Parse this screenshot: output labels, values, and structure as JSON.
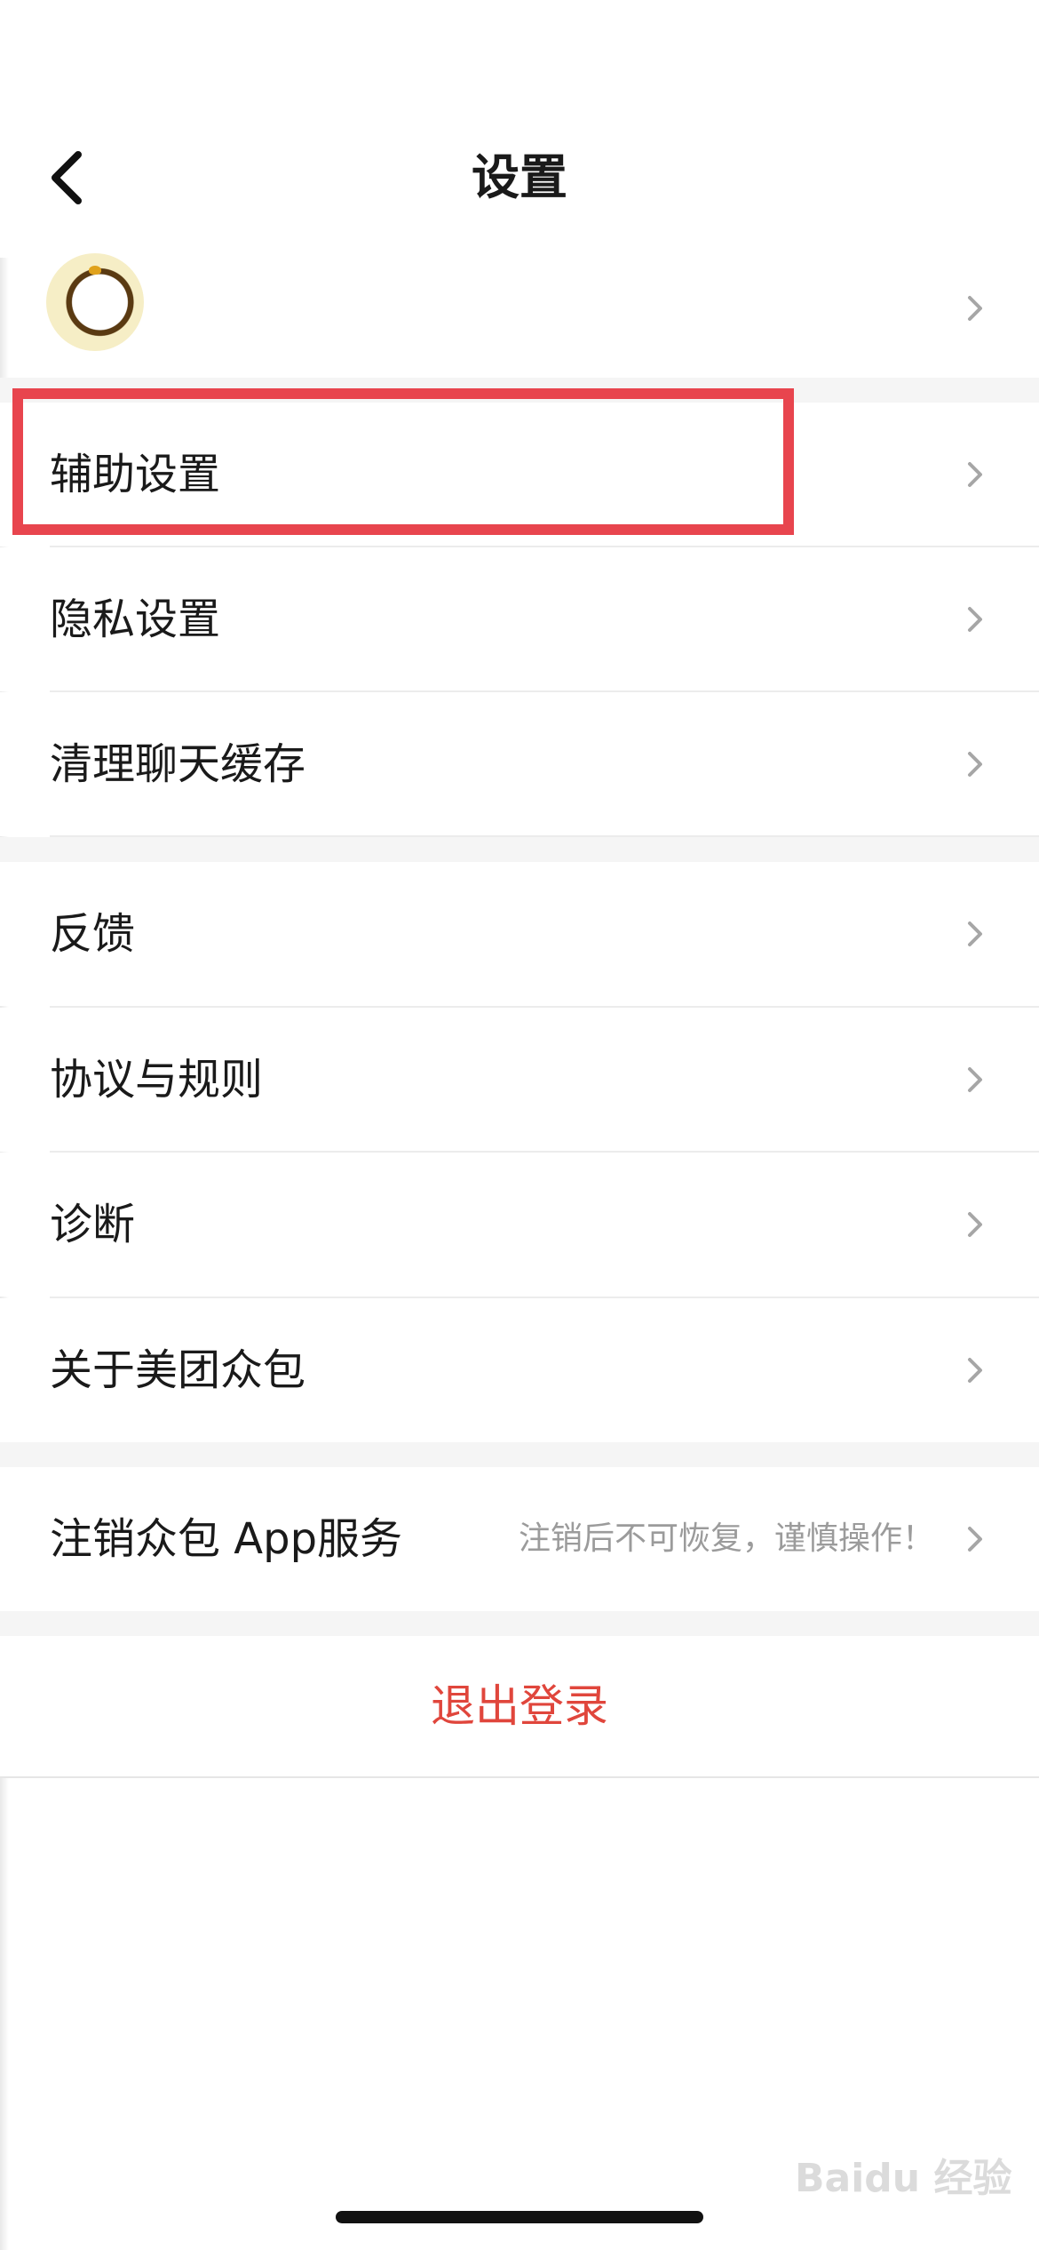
{
  "header": {
    "title": "设置",
    "back_icon": "chevron-left-icon"
  },
  "profile": {
    "avatar_icon": "avatar"
  },
  "groups": [
    {
      "items": [
        {
          "label": "辅助设置"
        },
        {
          "label": "隐私设置"
        },
        {
          "label": "清理聊天缓存"
        }
      ]
    },
    {
      "items": [
        {
          "label": "反馈"
        },
        {
          "label": "协议与规则"
        },
        {
          "label": "诊断"
        },
        {
          "label": "关于美团众包"
        }
      ]
    },
    {
      "items": [
        {
          "label": "注销众包 App服务",
          "hint": "注销后不可恢复，谨慎操作！"
        }
      ]
    }
  ],
  "logout": {
    "label": "退出登录",
    "color": "#e0463c"
  },
  "highlight": {
    "color": "#e8454e"
  },
  "watermark": {
    "text": "Baidu 经验"
  }
}
